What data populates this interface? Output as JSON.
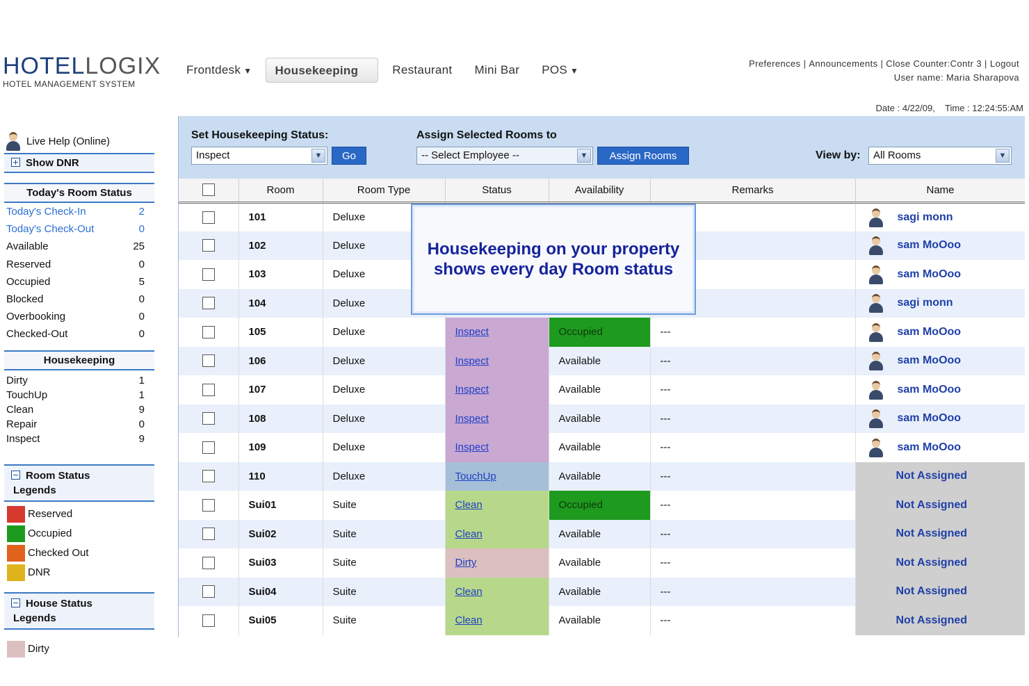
{
  "brand": {
    "name_part1": "HOTEL",
    "name_part2": "OGIX",
    "tagline": "HOTEL MANAGEMENT SYSTEM"
  },
  "nav": [
    {
      "label": "Frontdesk",
      "dropdown": true
    },
    {
      "label": "Housekeeping",
      "active": true
    },
    {
      "label": "Restaurant"
    },
    {
      "label": "Mini Bar"
    },
    {
      "label": "POS",
      "dropdown": true
    }
  ],
  "top_links": {
    "preferences": "Preferences",
    "announcements": "Announcements",
    "close_counter": "Close Counter:Contr 3",
    "logout": "Logout",
    "user": "User name: Maria Sharapova"
  },
  "datetime": "Date : 4/22/09,    Time : 12:24:55:AM",
  "sidebar": {
    "live_help": "Live Help (Online)",
    "show_dnr": "Show DNR",
    "todays_status_title": "Today's Room Status",
    "room_status": [
      {
        "label": "Today's Check-In",
        "value": "2",
        "link": true
      },
      {
        "label": "Today's Check-Out",
        "value": "0",
        "link": true
      },
      {
        "label": "Available",
        "value": "25"
      },
      {
        "label": "Reserved",
        "value": "0"
      },
      {
        "label": "Occupied",
        "value": "5"
      },
      {
        "label": "Blocked",
        "value": "0"
      },
      {
        "label": "Overbooking",
        "value": "0"
      },
      {
        "label": "Checked-Out",
        "value": "0"
      }
    ],
    "housekeeping_title": "Housekeeping",
    "housekeeping": [
      {
        "label": "Dirty",
        "value": "1"
      },
      {
        "label": "TouchUp",
        "value": "1"
      },
      {
        "label": "Clean",
        "value": "9"
      },
      {
        "label": "Repair",
        "value": "0"
      },
      {
        "label": "Inspect",
        "value": "9"
      }
    ],
    "room_legend_title_1": "Room Status",
    "room_legend_title_2": "Legends",
    "room_legends": [
      {
        "label": "Reserved",
        "color": "#d63a2f"
      },
      {
        "label": "Occupied",
        "color": "#1e9a1e"
      },
      {
        "label": "Checked Out",
        "color": "#e0621c"
      },
      {
        "label": "DNR",
        "color": "#e0b21c"
      }
    ],
    "house_legend_title_1": "House Status",
    "house_legend_title_2": "Legends",
    "house_legends": [
      {
        "label": "Dirty",
        "color": "#dcc0c0"
      }
    ]
  },
  "controls": {
    "set_status_label": "Set Housekeeping Status:",
    "status_value": "Inspect",
    "go_label": "Go",
    "assign_label": "Assign Selected Rooms to",
    "employee_value": "-- Select Employee --",
    "assign_button": "Assign Rooms",
    "view_by_label": "View by:",
    "view_by_value": "All Rooms"
  },
  "table": {
    "headers": [
      "Room",
      "Room Type",
      "Status",
      "Availability",
      "Remarks",
      "Name"
    ],
    "rows": [
      {
        "room": "101",
        "type": "Deluxe",
        "status": "",
        "availability": "",
        "remarks": "",
        "name": "sagi monn"
      },
      {
        "room": "102",
        "type": "Deluxe",
        "status": "",
        "availability": "",
        "remarks": "",
        "name": "sam MoOoo"
      },
      {
        "room": "103",
        "type": "Deluxe",
        "status": "",
        "availability": "",
        "remarks": "",
        "name": "sam MoOoo"
      },
      {
        "room": "104",
        "type": "Deluxe",
        "status": "",
        "availability": "",
        "remarks": "",
        "name": "sagi monn"
      },
      {
        "room": "105",
        "type": "Deluxe",
        "status": "Inspect",
        "availability": "Occupied",
        "remarks": "---",
        "name": "sam MoOoo"
      },
      {
        "room": "106",
        "type": "Deluxe",
        "status": "Inspect",
        "availability": "Available",
        "remarks": "---",
        "name": "sam MoOoo"
      },
      {
        "room": "107",
        "type": "Deluxe",
        "status": "Inspect",
        "availability": "Available",
        "remarks": "---",
        "name": "sam MoOoo"
      },
      {
        "room": "108",
        "type": "Deluxe",
        "status": "Inspect",
        "availability": "Available",
        "remarks": "---",
        "name": "sam MoOoo"
      },
      {
        "room": "109",
        "type": "Deluxe",
        "status": "Inspect",
        "availability": "Available",
        "remarks": "---",
        "name": "sam MoOoo"
      },
      {
        "room": "110",
        "type": "Deluxe",
        "status": "TouchUp",
        "availability": "Available",
        "remarks": "---",
        "name": "Not Assigned"
      },
      {
        "room": "Sui01",
        "type": "Suite",
        "status": "Clean",
        "availability": "Occupied",
        "remarks": "---",
        "name": "Not Assigned"
      },
      {
        "room": "Sui02",
        "type": "Suite",
        "status": "Clean",
        "availability": "Available",
        "remarks": "---",
        "name": "Not Assigned"
      },
      {
        "room": "Sui03",
        "type": "Suite",
        "status": "Dirty",
        "availability": "Available",
        "remarks": "---",
        "name": "Not Assigned"
      },
      {
        "room": "Sui04",
        "type": "Suite",
        "status": "Clean",
        "availability": "Available",
        "remarks": "---",
        "name": "Not Assigned"
      },
      {
        "room": "Sui05",
        "type": "Suite",
        "status": "Clean",
        "availability": "Available",
        "remarks": "---",
        "name": "Not Assigned"
      }
    ]
  },
  "popup": {
    "line1": "Housekeeping on your property",
    "line2": "shows every day Room status"
  }
}
